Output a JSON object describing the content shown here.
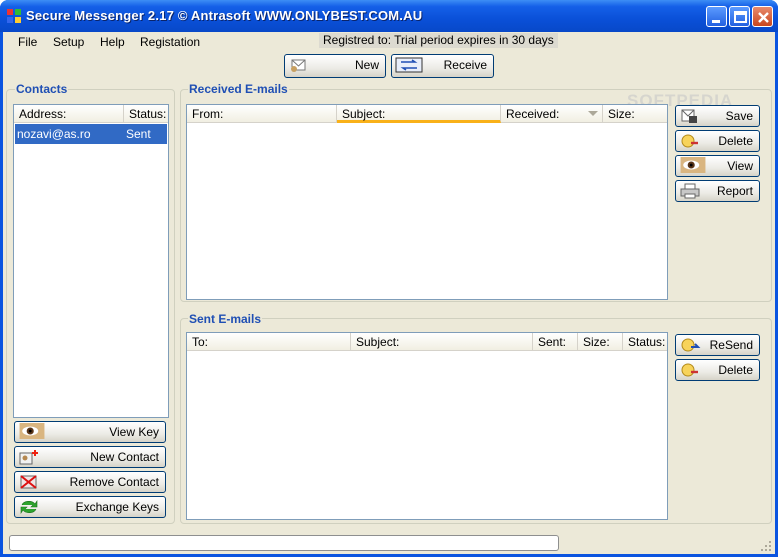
{
  "window": {
    "title": "Secure Messenger 2.17  © Antrasoft WWW.ONLYBEST.COM.AU",
    "watermark": "SOFTPEDIA"
  },
  "menu": {
    "items": [
      "File",
      "Setup",
      "Help",
      "Registation"
    ],
    "registration_status": "Registred to: Trial period expires in 30 days"
  },
  "toolbar": {
    "new_label": "New",
    "receive_label": "Receive"
  },
  "contacts": {
    "title": "Contacts",
    "columns": [
      "Address:",
      "Status:"
    ],
    "rows": [
      {
        "address": "nozavi@as.ro",
        "status": "Sent"
      }
    ],
    "buttons": {
      "view_key": "View Key",
      "new_contact": "New Contact",
      "remove_contact": "Remove Contact",
      "exchange_keys": "Exchange Keys"
    }
  },
  "received": {
    "title": "Received E-mails",
    "columns": [
      "From:",
      "Subject:",
      "Received:",
      "Size:"
    ],
    "buttons": {
      "save": "Save",
      "delete": "Delete",
      "view": "View",
      "report": "Report"
    }
  },
  "sent": {
    "title": "Sent E-mails",
    "columns": [
      "To:",
      "Subject:",
      "Sent:",
      "Size:",
      "Status:"
    ],
    "buttons": {
      "resend": "ReSend",
      "delete": "Delete"
    }
  },
  "colors": {
    "titlebar": "#0a54e0",
    "group_title": "#1f4fb4",
    "selection": "#316ac5",
    "sort_indicator": "#f9b119",
    "window_bg": "#ece9d8"
  }
}
